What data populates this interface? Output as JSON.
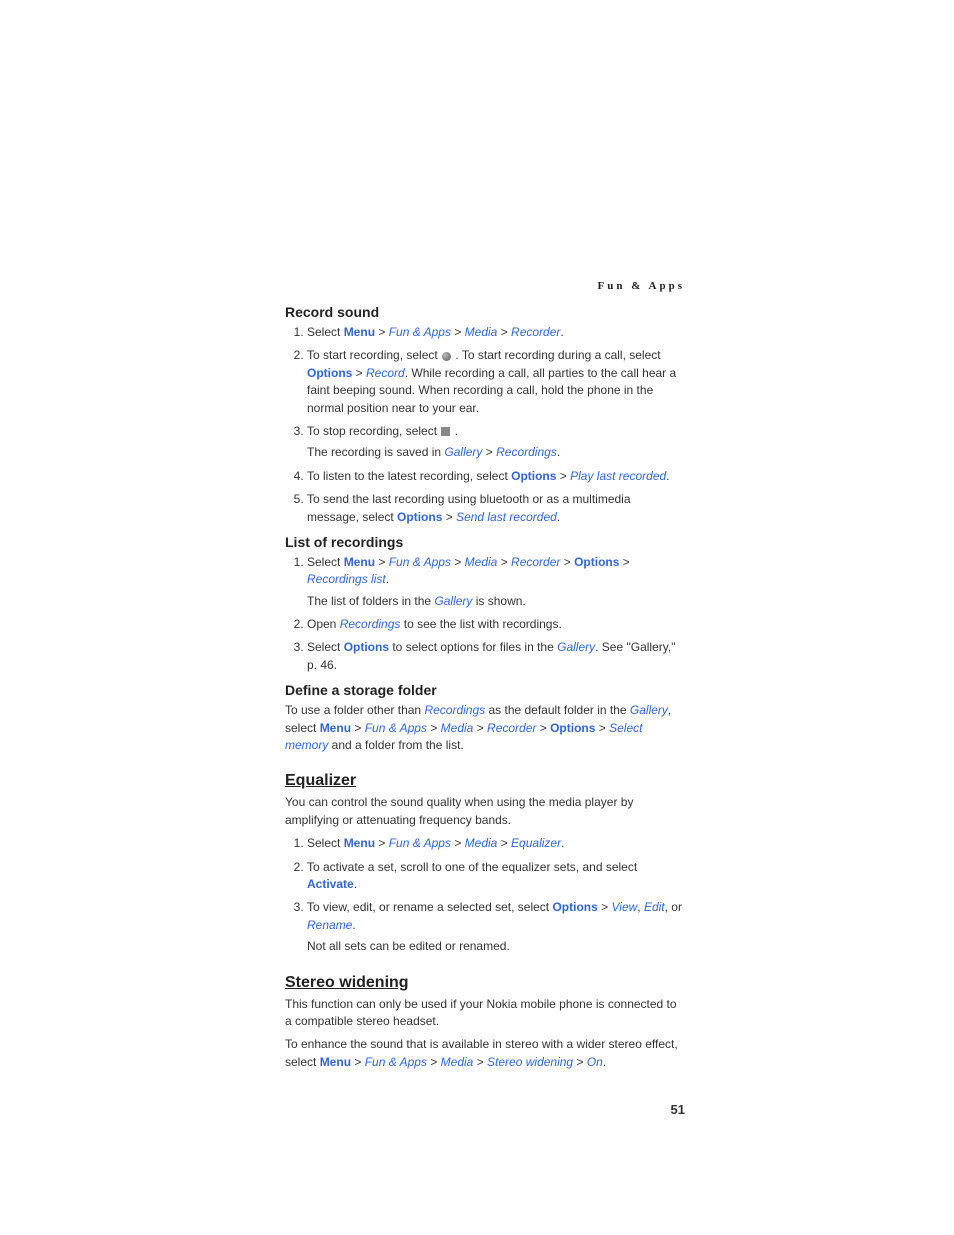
{
  "running_header": "Fun & Apps",
  "page_number": "51",
  "section_record_sound": {
    "title": "Record sound",
    "step1_prefix": "Select ",
    "step1_menu": "Menu",
    "step1_sep": " > ",
    "step1_fun": "Fun & Apps",
    "step1_media": "Media",
    "step1_recorder": "Recorder",
    "step1_period": ".",
    "step2_a": "To start recording, select ",
    "step2_b": " . To start recording during a call, select ",
    "step2_options": "Options",
    "step2_sep": " > ",
    "step2_record": "Record",
    "step2_c": ". While recording a call, all parties to the call hear a faint beeping sound. When recording a call, hold the phone in the normal position near to your ear.",
    "step3_a": "To stop recording, select ",
    "step3_b": " .",
    "step3_c": "The recording is saved in ",
    "step3_gallery": "Gallery",
    "step3_sep": " > ",
    "step3_recordings": "Recordings",
    "step3_period": ".",
    "step4_a": "To listen to the latest recording, select ",
    "step4_options": "Options",
    "step4_sep": " > ",
    "step4_play": "Play last recorded",
    "step4_period": ".",
    "step5_a": "To send the last recording using bluetooth or as a multimedia message, select ",
    "step5_options": "Options",
    "step5_sep": " > ",
    "step5_send": "Send last recorded",
    "step5_period": "."
  },
  "section_list": {
    "title": "List of recordings",
    "step1_prefix": "Select ",
    "step1_menu": "Menu",
    "step1_sep": " > ",
    "step1_fun": "Fun & Apps",
    "step1_media": "Media",
    "step1_recorder": "Recorder",
    "step1_options": "Options",
    "step1_reclist": "Recordings list",
    "step1_period": ".",
    "step1_sub_a": "The list of folders in the ",
    "step1_sub_gallery": "Gallery",
    "step1_sub_b": " is shown.",
    "step2_a": "Open ",
    "step2_recordings": "Recordings",
    "step2_b": " to see the list with recordings.",
    "step3_a": "Select ",
    "step3_options": "Options",
    "step3_b": " to select options for files in the ",
    "step3_gallery": "Gallery",
    "step3_c": ". See \"Gallery,\" p. 46."
  },
  "section_define": {
    "title": "Define a storage folder",
    "p_a": "To use a folder other than ",
    "p_recordings": "Recordings",
    "p_b": " as the default folder in the ",
    "p_gallery": "Gallery",
    "p_c": ", select ",
    "p_menu": "Menu",
    "p_sep": " > ",
    "p_fun": "Fun & Apps",
    "p_media": "Media",
    "p_recorder": "Recorder",
    "p_options": "Options",
    "p_selectmem": "Select memory",
    "p_d": " and a folder from the list."
  },
  "section_eq": {
    "title": "Equalizer",
    "intro": "You can control the sound quality when using the media player by amplifying or attenuating frequency bands.",
    "step1_prefix": "Select ",
    "step1_menu": "Menu",
    "step1_sep": " > ",
    "step1_fun": "Fun & Apps",
    "step1_media": "Media",
    "step1_eq": "Equalizer",
    "step1_period": ".",
    "step2_a": "To activate a set, scroll to one of the equalizer sets, and select ",
    "step2_activate": "Activate",
    "step2_period": ".",
    "step3_a": "To view, edit, or rename a selected set, select ",
    "step3_options": "Options",
    "step3_sep": " > ",
    "step3_view": "View",
    "step3_comma": ", ",
    "step3_edit": "Edit",
    "step3_or": ", or ",
    "step3_rename": "Rename",
    "step3_period": ".",
    "step3_sub": "Not all sets can be edited or renamed."
  },
  "section_stereo": {
    "title": "Stereo widening",
    "p1": "This function can only be used if your Nokia mobile phone is connected to a compatible stereo headset.",
    "p2_a": "To enhance the sound that is available in stereo with a wider stereo effect, select ",
    "p2_menu": "Menu",
    "p2_sep": " > ",
    "p2_fun": "Fun & Apps",
    "p2_media": "Media",
    "p2_sw": "Stereo widening",
    "p2_on": "On",
    "p2_period": "."
  }
}
